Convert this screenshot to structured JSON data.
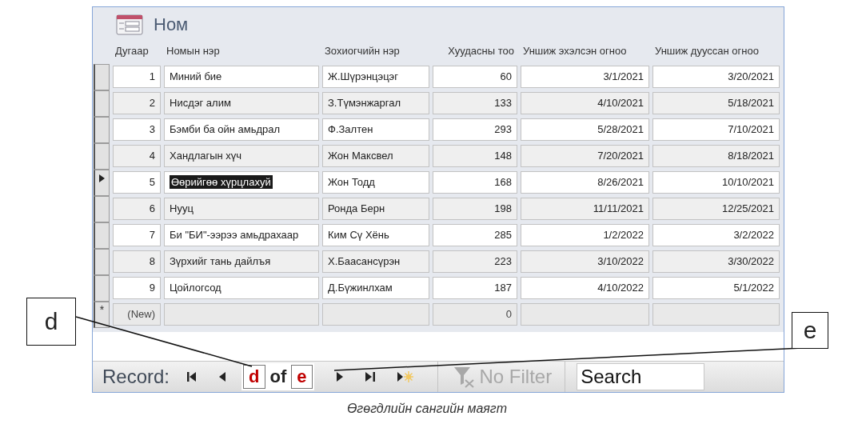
{
  "form": {
    "title": "Ном"
  },
  "columns": [
    "Дугаар",
    "Номын нэр",
    "Зохиогчийн нэр",
    "Хуудасны тоо",
    "Уншиж эхэлсэн огноо",
    "Уншиж дууссан огноо"
  ],
  "rows": [
    {
      "kind": "record",
      "selected": false,
      "cells": [
        "1",
        "Миний бие",
        "Ж.Шүрэнцэцэг",
        "60",
        "3/1/2021",
        "3/20/2021"
      ]
    },
    {
      "kind": "record",
      "selected": false,
      "cells": [
        "2",
        "Нисдэг алим",
        "З.Түмэнжаргал",
        "133",
        "4/10/2021",
        "5/18/2021"
      ]
    },
    {
      "kind": "record",
      "selected": false,
      "cells": [
        "3",
        "Бэмби ба ойн  амьдрал",
        "Ф.Залтен",
        "293",
        "5/28/2021",
        "7/10/2021"
      ]
    },
    {
      "kind": "record",
      "selected": false,
      "cells": [
        "4",
        "Хандлагын хүч",
        "Жон Максвел",
        "148",
        "7/20/2021",
        "8/18/2021"
      ]
    },
    {
      "kind": "record",
      "selected": true,
      "cells": [
        "5",
        "Өөрийгөө хүрцлахуй",
        "Жон Тодд",
        "168",
        "8/26/2021",
        "10/10/2021"
      ]
    },
    {
      "kind": "record",
      "selected": false,
      "cells": [
        "6",
        "Нууц",
        "Ронда Берн",
        "198",
        "11/11/2021",
        "12/25/2021"
      ]
    },
    {
      "kind": "record",
      "selected": false,
      "cells": [
        "7",
        "Би \"БИ\"-ээрээ амьдрахаар",
        "Ким Сү Хёнь",
        "285",
        "1/2/2022",
        "3/2/2022"
      ]
    },
    {
      "kind": "record",
      "selected": false,
      "cells": [
        "8",
        "Зүрхийг тань дайлъя",
        "Х.Баасансүрэн",
        "223",
        "3/10/2022",
        "3/30/2022"
      ]
    },
    {
      "kind": "record",
      "selected": false,
      "cells": [
        "9",
        "Цойлогсод",
        "Д.Бүжинлхам",
        "187",
        "4/10/2022",
        "5/1/2022"
      ]
    },
    {
      "kind": "new",
      "marker": "*",
      "cells": [
        "(New)",
        null,
        null,
        "0",
        null,
        null
      ]
    }
  ],
  "navigation": {
    "label": "Record:",
    "current": "d",
    "of": "of",
    "total": "e",
    "filter": {
      "label": "No Filter",
      "disabled": true
    },
    "search": {
      "placeholder": "Search"
    }
  },
  "callouts": [
    {
      "label": "d"
    },
    {
      "label": "e"
    }
  ],
  "caption": "Өгөгдлийн сангийн маягт"
}
